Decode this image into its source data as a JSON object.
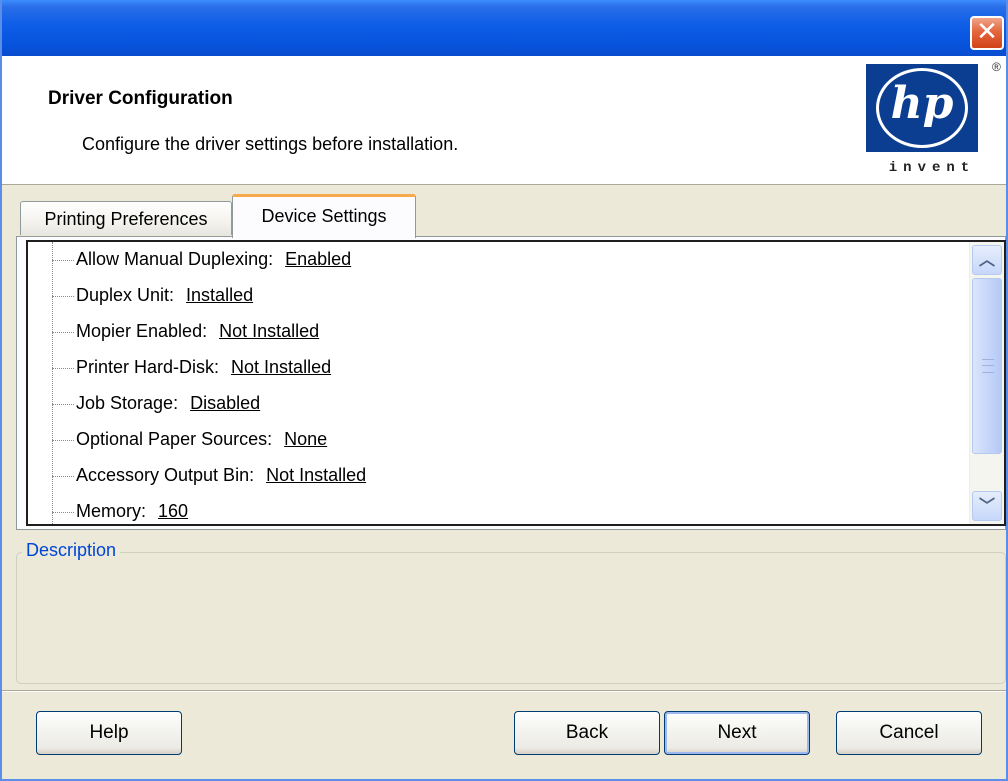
{
  "window": {
    "close_glyph": "✕"
  },
  "header": {
    "title": "Driver Configuration",
    "subtitle": "Configure the driver settings before installation.",
    "logo": {
      "letters": "hp",
      "registered": "®",
      "tagline": "invent",
      "color": "#0b3d91"
    }
  },
  "tabs": [
    {
      "label": "Printing Preferences",
      "active": false
    },
    {
      "label": "Device Settings",
      "active": true
    }
  ],
  "settings": [
    {
      "label": "Allow Manual Duplexing:",
      "value": "Enabled"
    },
    {
      "label": "Duplex Unit:",
      "value": "Installed"
    },
    {
      "label": "Mopier Enabled:",
      "value": "Not Installed"
    },
    {
      "label": "Printer Hard-Disk:",
      "value": "Not Installed"
    },
    {
      "label": "Job Storage:",
      "value": "Disabled"
    },
    {
      "label": "Optional Paper Sources:",
      "value": "None"
    },
    {
      "label": "Accessory Output Bin:",
      "value": "Not Installed"
    },
    {
      "label": "Memory:",
      "value": "160"
    }
  ],
  "scrollbar": {
    "up_glyph": "︿",
    "down_glyph": "﹀"
  },
  "description": {
    "legend": "Description",
    "text": ""
  },
  "buttons": {
    "help": "Help",
    "back": "Back",
    "next": "Next",
    "cancel": "Cancel"
  }
}
